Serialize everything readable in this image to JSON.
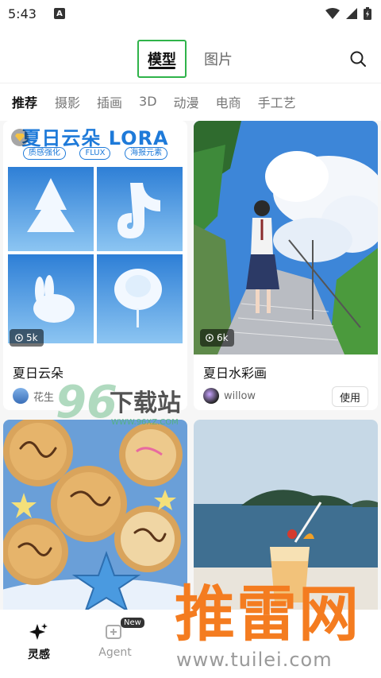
{
  "status_bar": {
    "time": "5:43",
    "a_badge": "A"
  },
  "top_tabs": {
    "active": "模型",
    "inactive": "图片"
  },
  "categories": [
    "推荐",
    "摄影",
    "插画",
    "3D",
    "动漫",
    "电商",
    "手工艺"
  ],
  "cards": [
    {
      "header_title": "夏日云朵 LORA",
      "tags": [
        "质感强化",
        "FLUX",
        "海报元素"
      ],
      "views": "5k",
      "title": "夏日云朵",
      "author": "花生"
    },
    {
      "views": "6k",
      "title": "夏日水彩画",
      "author": "willow",
      "use_label": "使用"
    }
  ],
  "bottom_nav": {
    "items": [
      {
        "label": "灵感",
        "icon": "sparkle-icon"
      },
      {
        "label": "Agent",
        "icon": "agent-icon",
        "badge": "New"
      }
    ]
  },
  "watermarks": {
    "site96": {
      "number": "96",
      "text": "下载站",
      "url": "WWW.96XZ.COM"
    },
    "tuilei": {
      "text": "推雷网",
      "url": "www.tuilei.com"
    }
  },
  "colors": {
    "accent_green": "#2fb34a",
    "lora_blue": "#1e7ad9",
    "watermark_orange": "#f47c20"
  }
}
